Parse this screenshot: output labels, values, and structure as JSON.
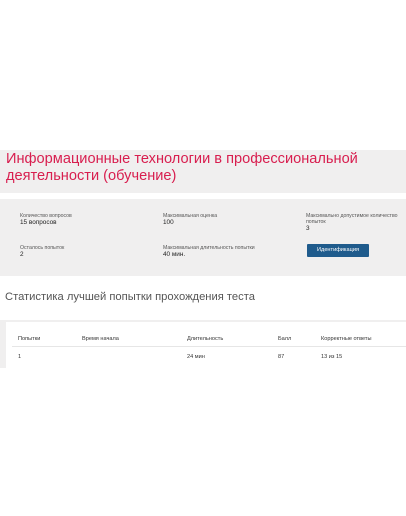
{
  "course": {
    "title": "Информационные технологии в профессиональной деятельности (обучение)"
  },
  "info": {
    "question_count": {
      "label": "Количество вопросов",
      "value": "15 вопросов"
    },
    "max_score": {
      "label": "Максимальная оценка",
      "value": "100"
    },
    "max_attempts": {
      "label": "Максимально допустимое количество попыток",
      "value": "3"
    },
    "attempts_left": {
      "label": "Осталось попыток",
      "value": "2"
    },
    "max_duration": {
      "label": "Максимальная длительность попытки",
      "value": "40 мин."
    },
    "identify_button_label": "Идентификация"
  },
  "stats": {
    "title": "Статистика лучшей попытки прохождения теста",
    "columns": [
      "Попытки",
      "Время начала",
      "Длительность",
      "Балл",
      "Корректные ответы"
    ],
    "rows": [
      [
        "1",
        "",
        "24 мин",
        "87",
        "13 из 15"
      ]
    ]
  }
}
